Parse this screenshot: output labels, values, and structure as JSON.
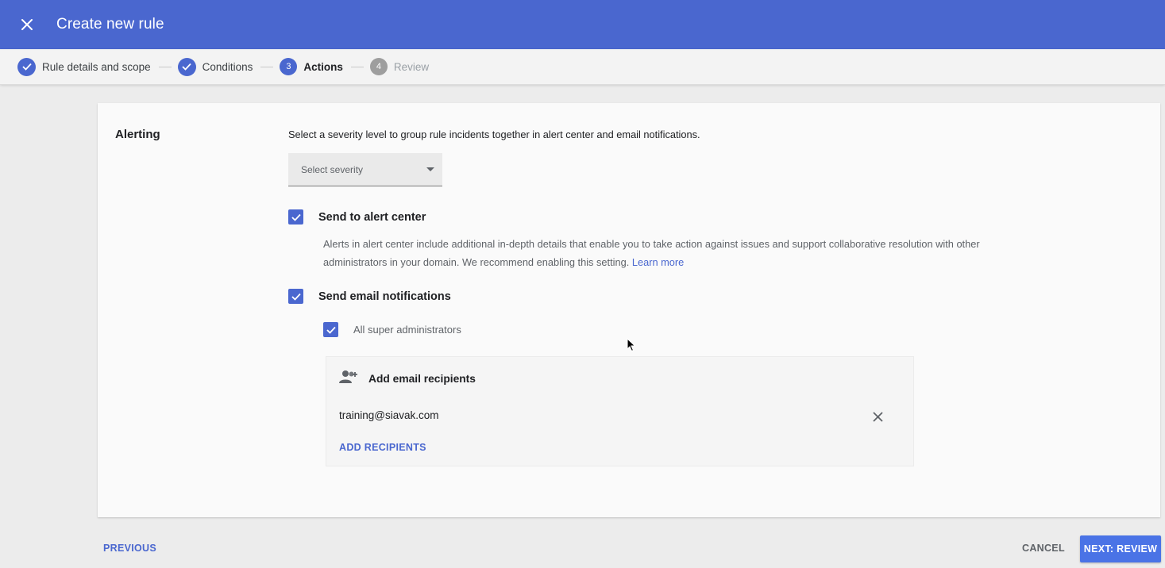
{
  "header": {
    "title": "Create new rule",
    "close_icon": "close-icon"
  },
  "stepper": {
    "steps": [
      {
        "label": "Rule details and scope",
        "state": "done",
        "number": "1"
      },
      {
        "label": "Conditions",
        "state": "done",
        "number": "2"
      },
      {
        "label": "Actions",
        "state": "current",
        "number": "3"
      },
      {
        "label": "Review",
        "state": "upcoming",
        "number": "4"
      }
    ]
  },
  "alerting": {
    "section_title": "Alerting",
    "description": "Select a severity level to group rule incidents together in alert center and email notifications.",
    "severity_placeholder": "Select severity",
    "send_to_alert_center": {
      "label": "Send to alert center",
      "checked": true,
      "description": "Alerts in alert center include additional in-depth details that enable you to take action against issues and support collaborative resolution with other administrators in your domain. We recommend enabling this setting.",
      "learn_more": "Learn more"
    },
    "send_email": {
      "label": "Send email notifications",
      "checked": true,
      "super_admins_label": "All super administrators",
      "super_admins_checked": true
    },
    "recipients": {
      "title": "Add email recipients",
      "emails": [
        "training@siavak.com"
      ],
      "add_label": "ADD RECIPIENTS"
    }
  },
  "footer": {
    "previous": "PREVIOUS",
    "cancel": "CANCEL",
    "next": "NEXT: REVIEW"
  },
  "colors": {
    "primary": "#4a67cf",
    "button": "#4a73e6"
  }
}
